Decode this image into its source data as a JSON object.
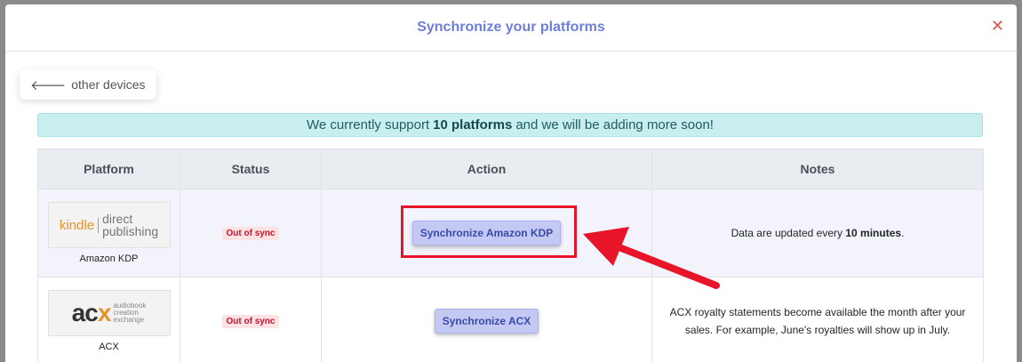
{
  "modal": {
    "title": "Synchronize your platforms",
    "close_glyph": "✕"
  },
  "back_button": {
    "arrow": "🡐",
    "label": "other devices"
  },
  "banner": {
    "prefix": "We currently support",
    "highlight": "10 platforms",
    "suffix": "and we will be adding more soon!"
  },
  "table": {
    "headers": [
      "Platform",
      "Status",
      "Action",
      "Notes"
    ],
    "rows": [
      {
        "platform": "Amazon KDP",
        "logo": {
          "kindle": "kindle",
          "line1": "direct",
          "line2": "publishing"
        },
        "status": "Out of sync",
        "action": "Synchronize Amazon KDP",
        "note_prefix": "Data are updated every",
        "note_bold": "10 minutes",
        "note_suffix": "."
      },
      {
        "platform": "ACX",
        "logo": {
          "main_a": "ac",
          "main_x": "x",
          "line1": "audiobook",
          "line2": "creation",
          "line3": "exchange"
        },
        "status": "Out of sync",
        "action": "Synchronize ACX",
        "note": "ACX royalty statements become available the month after your sales. For example, June's royalties will show up in July."
      }
    ]
  },
  "colors": {
    "title": "#6f7fd8",
    "banner_bg": "#c9eef0",
    "status_text": "#c8102e",
    "button_bg": "#c3c9f3",
    "annotation_red": "#e8152a"
  }
}
